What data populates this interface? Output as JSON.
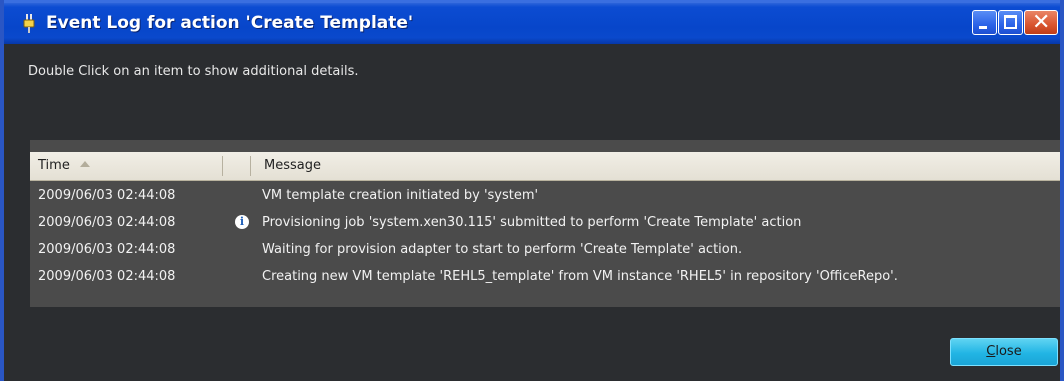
{
  "window": {
    "title": "Event Log for action 'Create Template'",
    "controls": [
      "minimize",
      "maximize",
      "close"
    ]
  },
  "hint": "Double Click on an item to show additional details.",
  "grid": {
    "columns": [
      {
        "label": "Time",
        "sorted": "ascending"
      },
      {
        "label": ""
      },
      {
        "label": "Message"
      }
    ],
    "rows": [
      {
        "time": "2009/06/03 02:44:08",
        "icon": "",
        "message": "VM template creation initiated by 'system'"
      },
      {
        "time": "2009/06/03 02:44:08",
        "icon": "info-icon",
        "message": "Provisioning job 'system.xen30.115' submitted to perform 'Create Template' action"
      },
      {
        "time": "2009/06/03 02:44:08",
        "icon": "",
        "message": "Waiting for provision adapter to start to perform 'Create Template' action."
      },
      {
        "time": "2009/06/03 02:44:08",
        "icon": "",
        "message": "Creating new VM template 'REHL5_template' from VM instance 'RHEL5' in repository 'OfficeRepo'."
      }
    ]
  },
  "footer": {
    "close_label": "Close"
  },
  "colors": {
    "titlebar": "#0746ca",
    "background": "#2b2d30",
    "grid_body": "#4b4b4b",
    "accent_button": "#22b5e4"
  }
}
